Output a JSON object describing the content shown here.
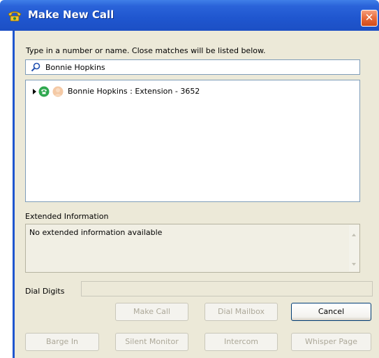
{
  "window": {
    "title": "Make New Call",
    "close_glyph": "✕",
    "app_icon": "telephone-icon"
  },
  "search": {
    "prompt": "Type in a number or name.  Close matches will be listed below.",
    "value": "Bonnie Hopkins",
    "icon": "search-icon"
  },
  "results": [
    {
      "label": "Bonnie Hopkins : Extension - 3652",
      "status_icon": "phone-status-icon",
      "avatar_icon": "avatar-icon"
    }
  ],
  "extended_info": {
    "label": "Extended Information",
    "text": "No extended information available"
  },
  "dial_digits": {
    "label": "Dial Digits",
    "value": ""
  },
  "buttons_row1": {
    "make_call": "Make Call",
    "dial_mailbox": "Dial Mailbox",
    "cancel": "Cancel"
  },
  "buttons_row2": {
    "barge_in": "Barge In",
    "silent_monitor": "Silent Monitor",
    "intercom": "Intercom",
    "whisper_page": "Whisper Page"
  },
  "colors": {
    "title_bar": "#2a63d9",
    "dialog_bg": "#ece9d8",
    "close_button": "#e86a3a"
  }
}
